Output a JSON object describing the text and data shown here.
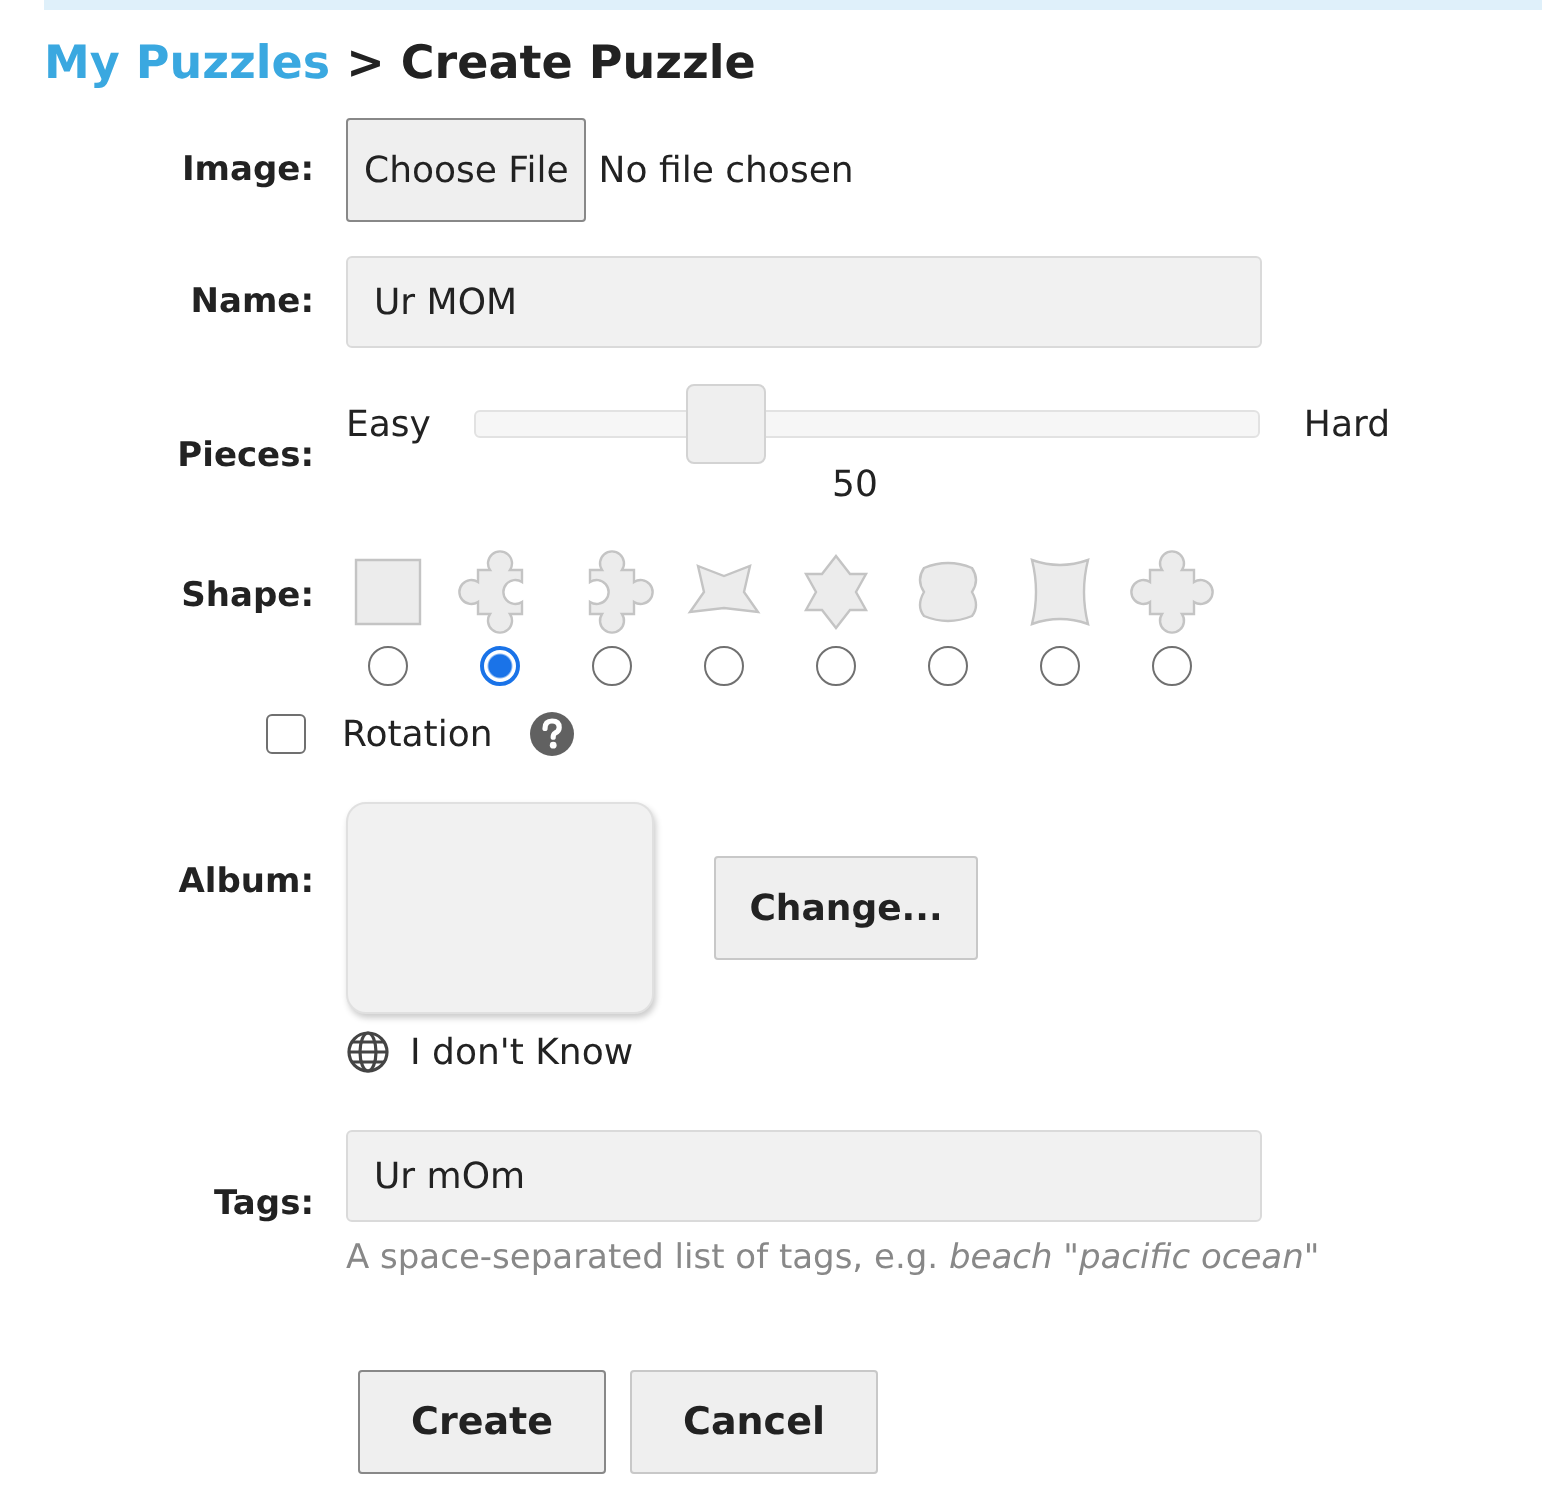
{
  "breadcrumb": {
    "link": "My Puzzles",
    "separator": ">",
    "current": "Create Puzzle"
  },
  "image": {
    "label": "Image:",
    "button": "Choose File",
    "status": "No file chosen"
  },
  "name": {
    "label": "Name:",
    "value": "Ur MOM"
  },
  "pieces": {
    "label": "Pieces:",
    "min_label": "Easy",
    "max_label": "Hard",
    "level": 0.3,
    "reading": "50"
  },
  "shape": {
    "label": "Shape:",
    "options": [
      {
        "kind": "square",
        "selected": false
      },
      {
        "kind": "jigsaw-a",
        "selected": true
      },
      {
        "kind": "jigsaw-b",
        "selected": false
      },
      {
        "kind": "star-wide",
        "selected": false
      },
      {
        "kind": "star-tall",
        "selected": false
      },
      {
        "kind": "leather",
        "selected": false
      },
      {
        "kind": "barrel",
        "selected": false
      },
      {
        "kind": "gear",
        "selected": false
      }
    ]
  },
  "rotation": {
    "label": "Rotation",
    "checked": false
  },
  "album": {
    "label": "Album:",
    "button": "Change...",
    "caption": "I don't Know"
  },
  "tags": {
    "label": "Tags:",
    "value": "Ur mOm",
    "hint": "A space-separated list of tags, e.g. *beach \"pacific ocean\"*"
  },
  "buttons": [
    "Create",
    "Cancel"
  ]
}
